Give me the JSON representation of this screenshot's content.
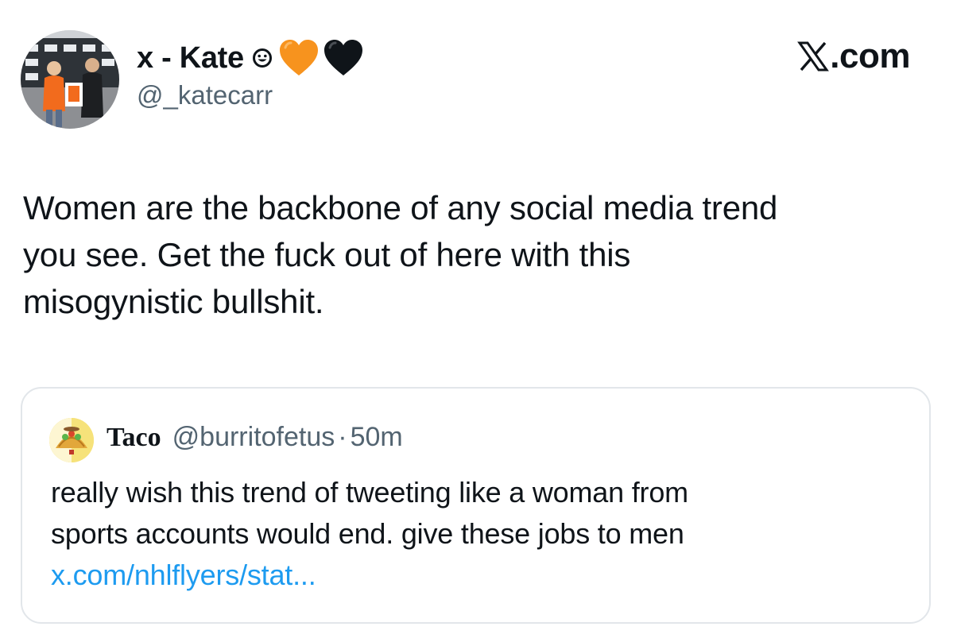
{
  "author": {
    "display_name": "x - Kate",
    "handle": "@_katecarr",
    "name_emojis": [
      "smiling-face-icon",
      "orange-heart-icon",
      "black-heart-icon"
    ]
  },
  "brand": {
    "label": ".com",
    "logo": "x-logo-icon"
  },
  "tweet": {
    "lines": [
      "Women are the backbone of any social media trend",
      "you see. Get the fuck out of here with this",
      "misogynistic bullshit."
    ]
  },
  "quoted": {
    "name": "Taco",
    "handle": "@burritofetus",
    "separator": "·",
    "time": "50m",
    "lines": [
      "really wish this trend of tweeting like a woman from",
      "sports accounts would end. give these jobs to men"
    ],
    "link": "x.com/nhlflyers/stat..."
  },
  "colors": {
    "text": "#0f1419",
    "secondary": "#536471",
    "link": "#1d9bf0",
    "border": "#e2e6ea",
    "orange_heart": "#f7931e"
  }
}
